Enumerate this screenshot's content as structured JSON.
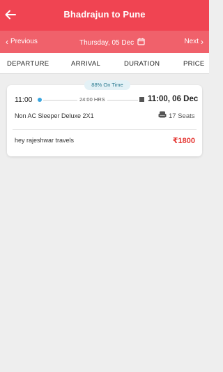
{
  "header": {
    "title": "Bhadrajun to Pune",
    "back_icon": "arrow-left-icon"
  },
  "date_nav": {
    "previous_label": "Previous",
    "next_label": "Next",
    "date": "Thursday, 05 Dec",
    "calendar_icon": "calendar-icon"
  },
  "sort": {
    "departure": "DEPARTURE",
    "arrival": "ARRIVAL",
    "duration": "DURATION",
    "price": "PRICE"
  },
  "results": [
    {
      "on_time": "88% On Time",
      "departure_time": "11:00",
      "duration": "24:00 HRS",
      "arrival_time": "11:00, 06 Dec",
      "bus_type": "Non AC Sleeper Deluxe 2X1",
      "seats": "17 Seats",
      "operator": "hey rajeshwar travels",
      "price": "₹1800"
    }
  ],
  "colors": {
    "primary": "#f04452",
    "secondary": "#f0616b",
    "price": "#e53935",
    "badge_bg": "#e3f1f6",
    "badge_text": "#2a7a8f",
    "departure_dot": "#3aa6e0"
  }
}
